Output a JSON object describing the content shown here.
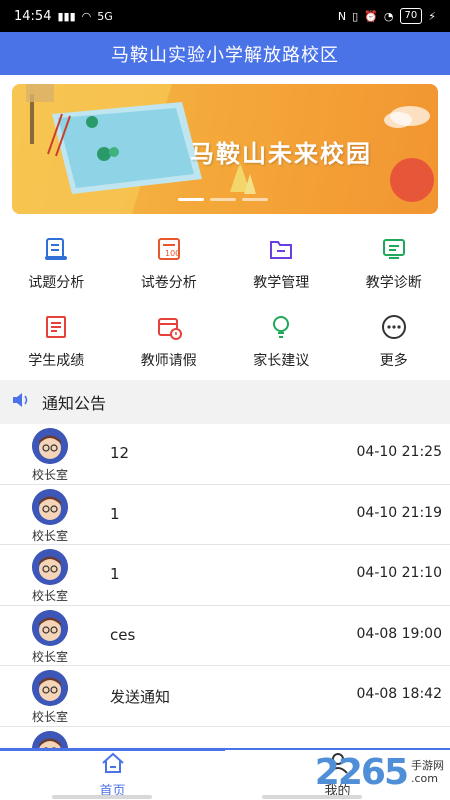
{
  "status_bar": {
    "time": "14:54",
    "signal_text": "全",
    "net_icons": "5G",
    "battery": "70"
  },
  "header": {
    "title": "马鞍山实验小学解放路校区"
  },
  "banner": {
    "title": "马鞍山未来校园"
  },
  "menu": [
    {
      "label": "试题分析",
      "icon": "scroll-icon",
      "color": "#2f6fd6"
    },
    {
      "label": "试卷分析",
      "icon": "exam-paper-icon",
      "color": "#e8562d"
    },
    {
      "label": "教学管理",
      "icon": "folder-icon",
      "color": "#6a3ee0"
    },
    {
      "label": "教学诊断",
      "icon": "monitor-icon",
      "color": "#1fa85a"
    },
    {
      "label": "学生成绩",
      "icon": "report-card-icon",
      "color": "#e5413b"
    },
    {
      "label": "教师请假",
      "icon": "calendar-clock-icon",
      "color": "#e5413b"
    },
    {
      "label": "家长建议",
      "icon": "lightbulb-icon",
      "color": "#1fa85a"
    },
    {
      "label": "更多",
      "icon": "more-dots-icon",
      "color": "#333333"
    }
  ],
  "notices": {
    "heading": "通知公告",
    "items": [
      {
        "sender": "校长室",
        "title": "12",
        "time": "04-10 21:25"
      },
      {
        "sender": "校长室",
        "title": "1",
        "time": "04-10 21:19"
      },
      {
        "sender": "校长室",
        "title": "1",
        "time": "04-10 21:10"
      },
      {
        "sender": "校长室",
        "title": "ces",
        "time": "04-08 19:00"
      },
      {
        "sender": "校长室",
        "title": "发送通知",
        "time": "04-08 18:42"
      },
      {
        "sender": "",
        "title": "",
        "time": ""
      }
    ]
  },
  "tabbar": {
    "home": "首页",
    "mine": "我的"
  },
  "watermark": {
    "number": "2265",
    "line1": "手游网",
    "line2": ".com"
  },
  "colors": {
    "primary": "#4a73e8",
    "banner_orange": "#f4a93a"
  }
}
